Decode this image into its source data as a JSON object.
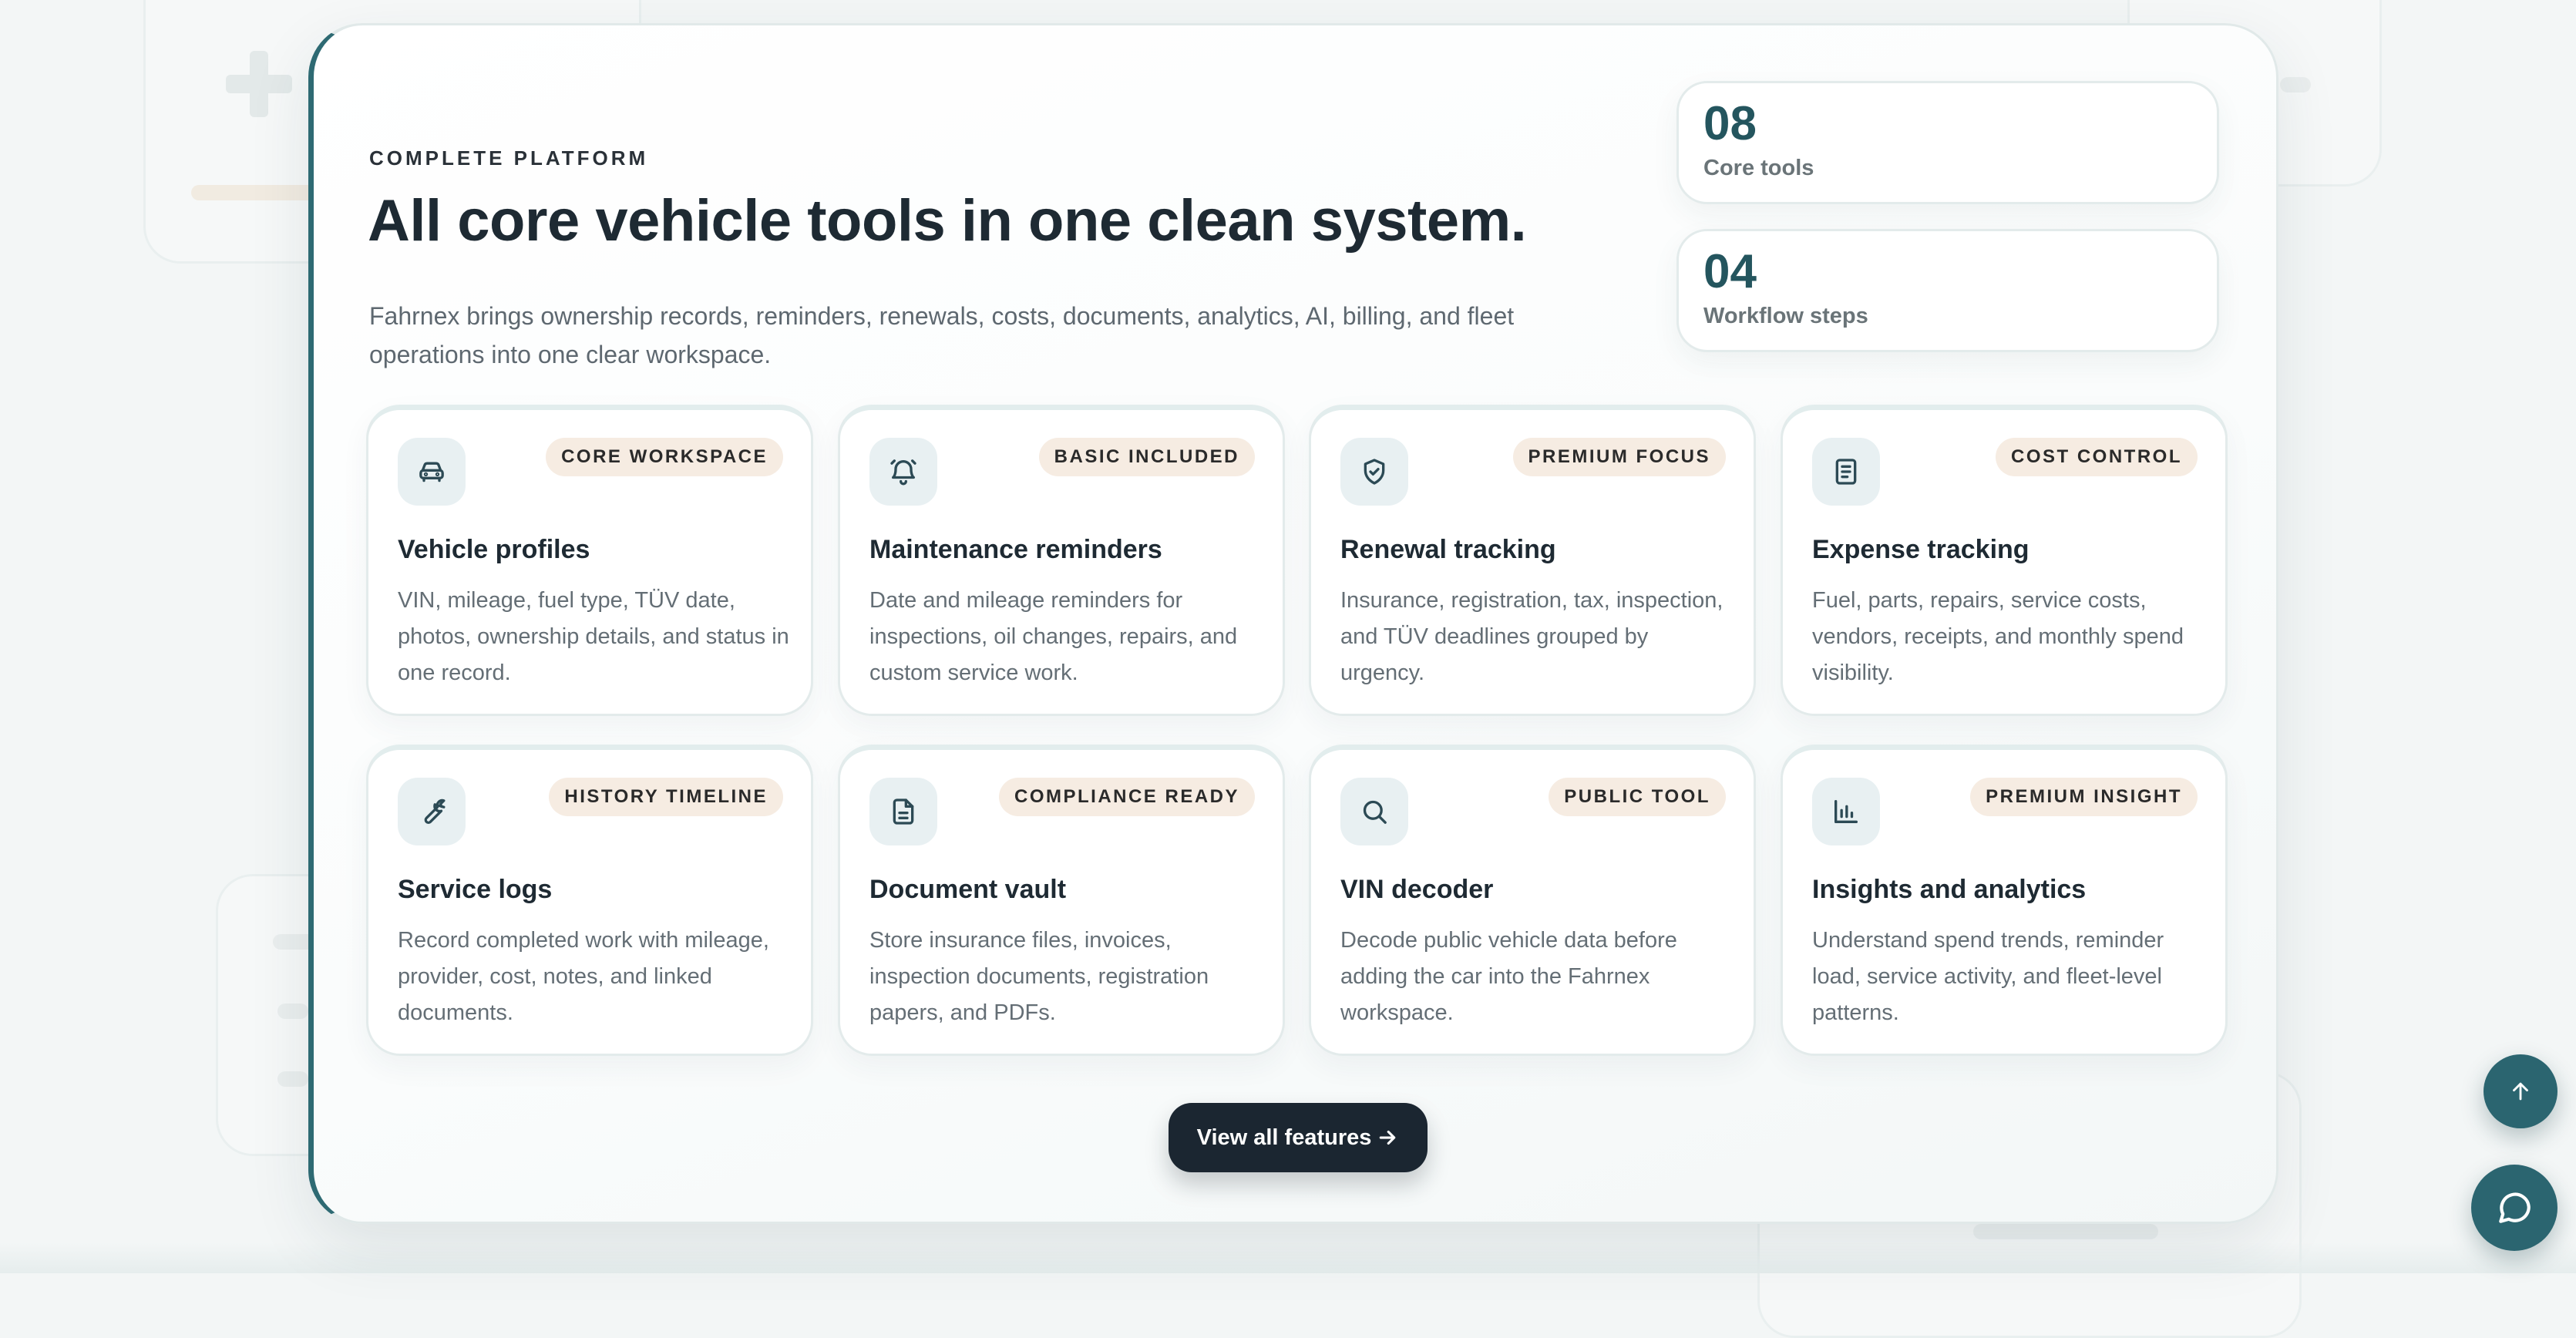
{
  "section": {
    "eyebrow": "COMPLETE PLATFORM",
    "headline": "All core vehicle tools in one clean system.",
    "description": "Fahrnex brings ownership records, reminders, renewals, costs, documents, analytics, AI, billing, and fleet operations into one clear workspace."
  },
  "stats": [
    {
      "value": "08",
      "label": "Core tools"
    },
    {
      "value": "04",
      "label": "Workflow steps"
    }
  ],
  "features": [
    {
      "icon": "car-icon",
      "badge": "CORE WORKSPACE",
      "title": "Vehicle profiles",
      "description": "VIN, mileage, fuel type, TÜV date, photos, ownership details, and status in one record."
    },
    {
      "icon": "bell-icon",
      "badge": "BASIC INCLUDED",
      "title": "Maintenance reminders",
      "description": "Date and mileage reminders for inspections, oil changes, repairs, and custom service work."
    },
    {
      "icon": "shield-check-icon",
      "badge": "PREMIUM FOCUS",
      "title": "Renewal tracking",
      "description": "Insurance, registration, tax, inspection, and TÜV deadlines grouped by urgency."
    },
    {
      "icon": "receipt-icon",
      "badge": "COST CONTROL",
      "title": "Expense tracking",
      "description": "Fuel, parts, repairs, service costs, vendors, receipts, and monthly spend visibility."
    },
    {
      "icon": "wrench-icon",
      "badge": "HISTORY TIMELINE",
      "title": "Service logs",
      "description": "Record completed work with mileage, provider, cost, notes, and linked documents."
    },
    {
      "icon": "document-icon",
      "badge": "COMPLIANCE READY",
      "title": "Document vault",
      "description": "Store insurance files, invoices, inspection documents, registration papers, and PDFs."
    },
    {
      "icon": "search-icon",
      "badge": "PUBLIC TOOL",
      "title": "VIN decoder",
      "description": "Decode public vehicle data before adding the car into the Fahrnex workspace."
    },
    {
      "icon": "bar-chart-icon",
      "badge": "PREMIUM INSIGHT",
      "title": "Insights and analytics",
      "description": "Understand spend trends, reminder load, service activity, and fleet-level patterns."
    }
  ],
  "cta": {
    "label": "View all features",
    "icon": "arrow-right-icon"
  },
  "floating": {
    "scroll_top_icon": "arrow-up-icon",
    "chat_icon": "chat-bubble-icon"
  },
  "colors": {
    "accent": "#2b6570",
    "stat_number": "#24555e",
    "badge_bg": "#f6ece2",
    "button_bg": "#1b2631",
    "icon_tile_bg": "#e8f0f2",
    "page_bg": "#f3f6f6"
  }
}
